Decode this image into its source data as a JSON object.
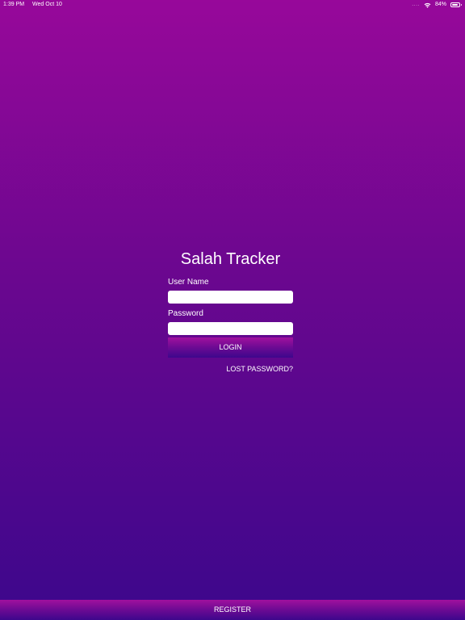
{
  "status_bar": {
    "time": "1:39 PM",
    "date": "Wed Oct 10",
    "signal": "....",
    "battery_percent": "84%",
    "battery_level": 0.84,
    "icons": [
      "wifi-icon",
      "battery-icon"
    ]
  },
  "login": {
    "title": "Salah Tracker",
    "username_label": "User Name",
    "username_value": "",
    "password_label": "Password",
    "password_value": "",
    "login_label": "LOGIN",
    "lost_password_label": "LOST PASSWORD?"
  },
  "footer": {
    "register_label": "REGISTER"
  },
  "colors": {
    "background_top": "#97089a",
    "background_bottom": "#3c078c",
    "field_background": "#ffffff",
    "text": "#ffffff"
  }
}
